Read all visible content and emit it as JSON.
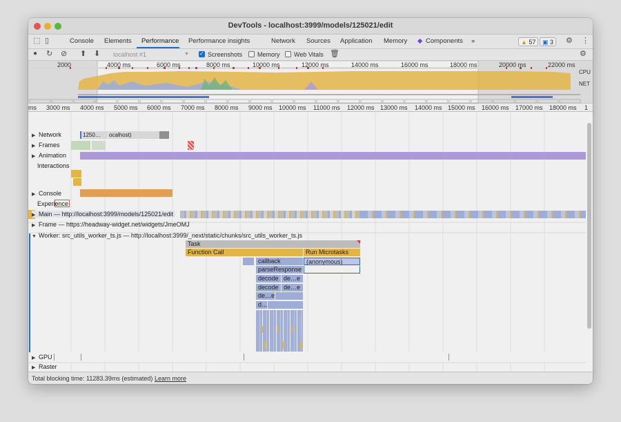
{
  "window": {
    "title": "DevTools - localhost:3999/models/125021/edit"
  },
  "tabs": [
    {
      "label": "Console"
    },
    {
      "label": "Elements"
    },
    {
      "label": "Performance"
    },
    {
      "label": "Performance insights"
    },
    {
      "label": "Network"
    },
    {
      "label": "Sources"
    },
    {
      "label": "Application"
    },
    {
      "label": "Memory"
    },
    {
      "label": "Components"
    }
  ],
  "badges": {
    "warnings": "57",
    "messages": "3"
  },
  "toolbar": {
    "profile_select": "localhost #1",
    "screenshots_label": "Screenshots",
    "memory_label": "Memory",
    "webvitals_label": "Web Vitals"
  },
  "overview": {
    "ticks": [
      "2000",
      "4000 ms",
      "6000 ms",
      "8000 ms",
      "10000 ms",
      "12000 ms",
      "14000 ms",
      "16000 ms",
      "18000 ms",
      "20000 ms",
      "22000 ms"
    ],
    "cpu_label": "CPU",
    "net_label": "NET"
  },
  "ruler": {
    "ticks": [
      "ms",
      "3000 ms",
      "4000 ms",
      "5000 ms",
      "6000 ms",
      "7000 ms",
      "8000 ms",
      "9000 ms",
      "10000 ms",
      "11000 ms",
      "12000 ms",
      "13000 ms",
      "14000 ms",
      "15000 ms",
      "16000 ms",
      "17000 ms",
      "18000 ms",
      "1"
    ]
  },
  "tracks": {
    "network": "Network",
    "network_item1": "1250…",
    "network_item2": "ocalhost)",
    "frames": "Frames",
    "animation": "Animation",
    "interactions": "Interactions",
    "console": "Console",
    "experience": "Experience",
    "main": "Main — http://localhost:3999/models/125021/edit",
    "frame": "Frame — https://headway-widget.net/widgets/JmeOMJ",
    "worker": "Worker: src_utils_worker_ts.js — http://localhost:3999/_next/static/chunks/src_utils_worker_ts.js",
    "raster": "Raster",
    "gpu": "GPU"
  },
  "flame": {
    "task": "Task",
    "function_call": "Function Call",
    "run_microtasks": "Run Microtasks",
    "callback": "callback",
    "anonymous": "(anonymous)",
    "parse_response": "parseResponse",
    "decode1": "decode",
    "decode1b": "de…e",
    "decode2": "decode",
    "decode2b": "de…e",
    "dee": "de…e",
    "d": "d…"
  },
  "status": {
    "text": "Total blocking time: 11283.39ms (estimated)",
    "link": "Learn more"
  },
  "colors": {
    "task_grey": "#c8c8c8",
    "function_yellow": "#f2c14e",
    "scripting_blue": "#a8b8e6",
    "selection": "#1a73e8",
    "animation_purple": "#b6a3e6",
    "console_orange": "#f0a95b"
  }
}
